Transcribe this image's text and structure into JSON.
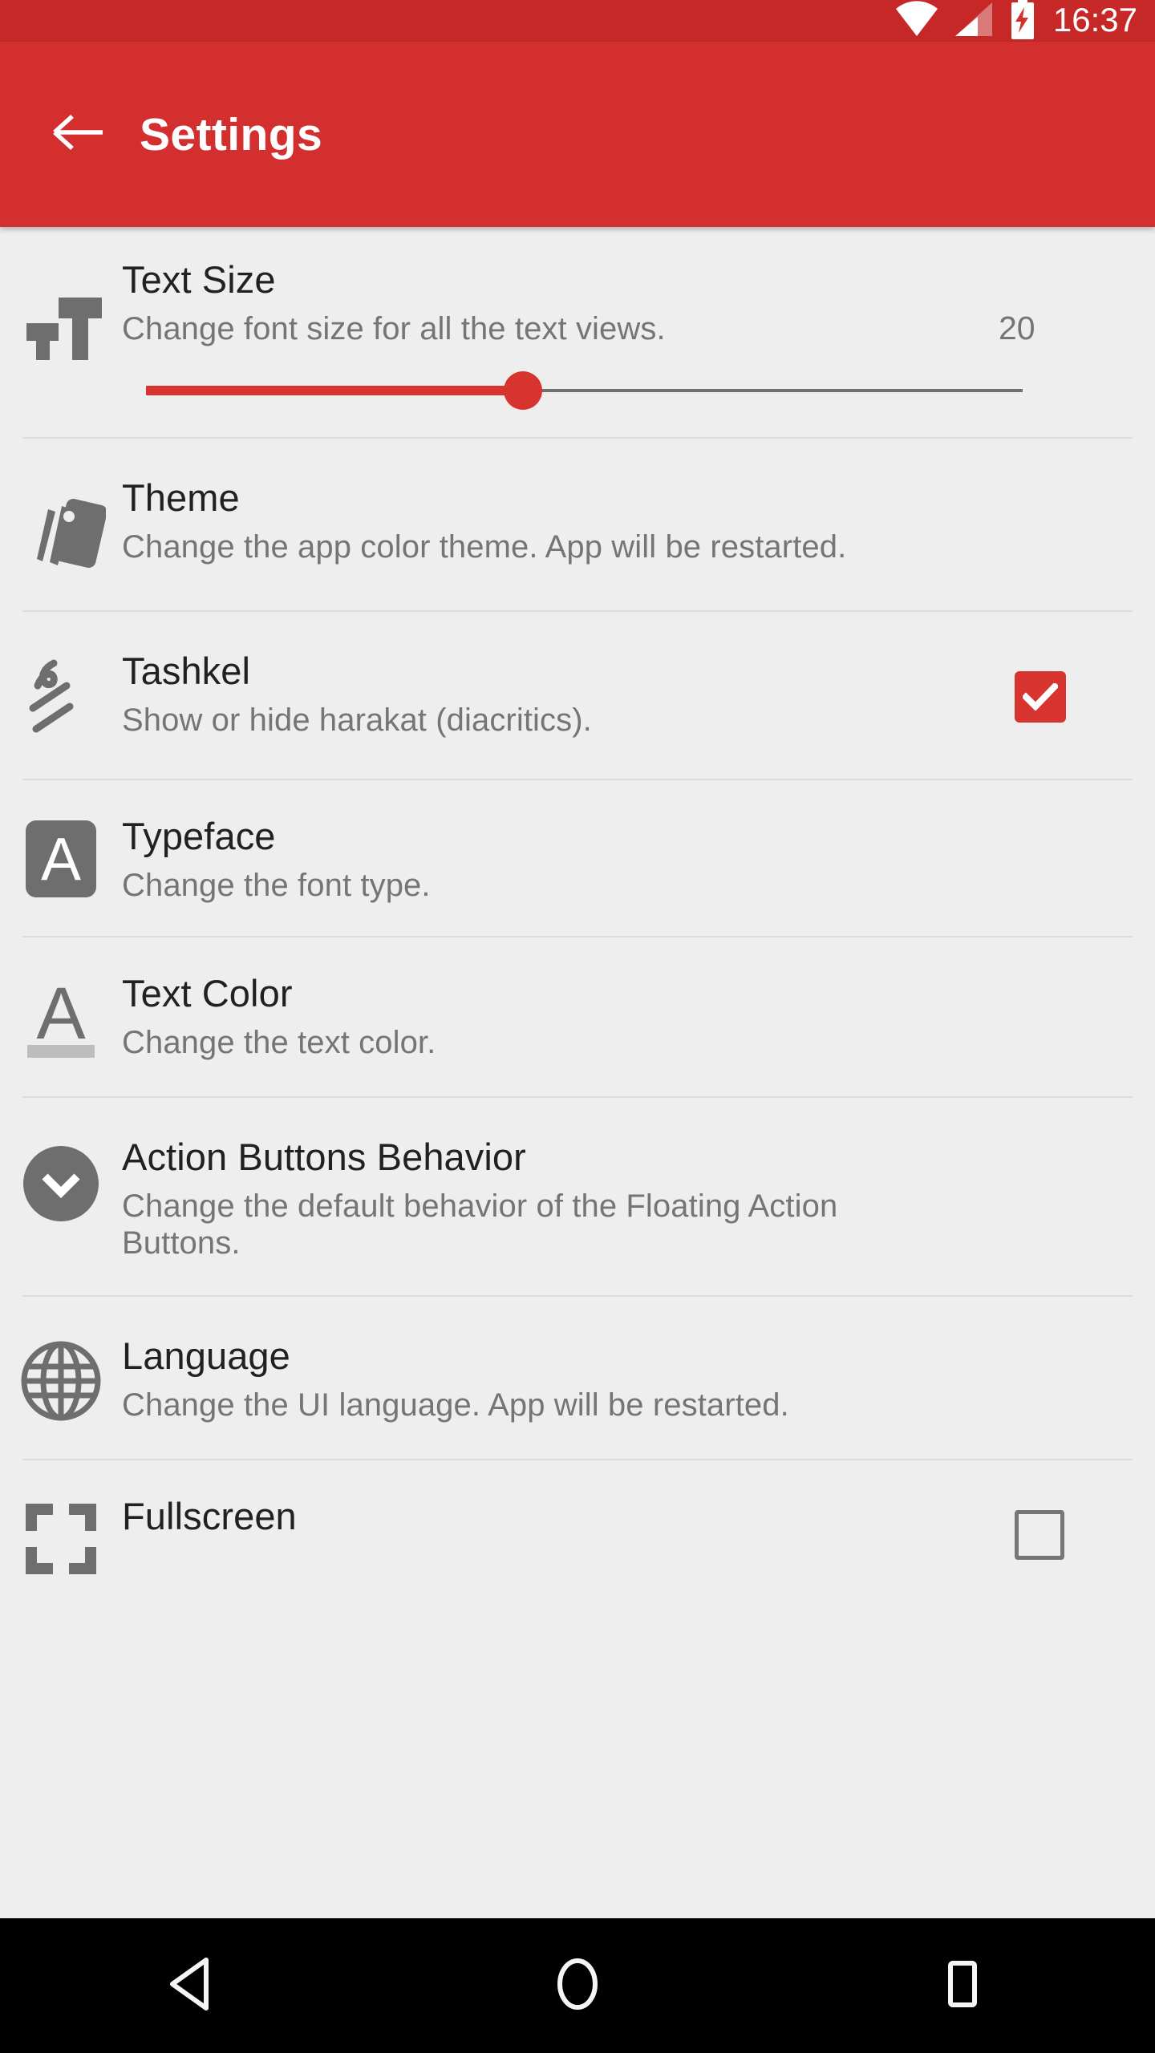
{
  "status_bar": {
    "time": "16:37",
    "icons": [
      "wifi-icon",
      "cellular-signal-icon",
      "battery-charging-icon"
    ],
    "background_color": "#c62828"
  },
  "app_bar": {
    "title": "Settings",
    "back_icon": "arrow-left-icon",
    "background_color": "#d32f2f",
    "text_color": "#ffffff"
  },
  "theme_colors": {
    "accent": "#d8342f",
    "primary": "#d32f2f",
    "primary_dark": "#c62828",
    "list_background": "#eeeeee",
    "title_text": "#212121",
    "subtitle_text": "#757575",
    "icon_gray": "#6e6e6e",
    "divider": "#dcdcdc"
  },
  "settings": [
    {
      "id": "text-size",
      "icon": "text-size-icon",
      "title": "Text Size",
      "subtitle": "Change font size for all the text views.",
      "value": "20",
      "control": "slider",
      "slider": {
        "percent": 43,
        "min": 0,
        "max": 100
      }
    },
    {
      "id": "theme",
      "icon": "color-palette-icon",
      "title": "Theme",
      "subtitle": "Change the app color theme. App will be restarted.",
      "control": "none"
    },
    {
      "id": "tashkel",
      "icon": "tashkel-diacritics-icon",
      "title": "Tashkel",
      "subtitle": "Show or hide harakat (diacritics).",
      "control": "checkbox",
      "checked": true
    },
    {
      "id": "typeface",
      "icon": "typeface-a-square-icon",
      "title": "Typeface",
      "subtitle": "Change the font type.",
      "control": "none"
    },
    {
      "id": "text-color",
      "icon": "text-color-a-icon",
      "title": "Text Color",
      "subtitle": "Change the text color.",
      "control": "none"
    },
    {
      "id": "action-buttons-behavior",
      "icon": "chevron-down-circle-icon",
      "title": "Action Buttons Behavior",
      "subtitle": "Change the default behavior of the Floating Action Buttons.",
      "control": "none"
    },
    {
      "id": "language",
      "icon": "globe-icon",
      "title": "Language",
      "subtitle": "Change the UI language. App will be restarted.",
      "control": "none"
    },
    {
      "id": "fullscreen",
      "icon": "fullscreen-corners-icon",
      "title": "Fullscreen",
      "subtitle": "",
      "control": "checkbox",
      "checked": false
    }
  ],
  "nav_bar": {
    "background_color": "#000000",
    "buttons": [
      {
        "id": "back",
        "icon": "nav-back-triangle-icon"
      },
      {
        "id": "home",
        "icon": "nav-home-circle-icon"
      },
      {
        "id": "recents",
        "icon": "nav-recents-square-icon"
      }
    ]
  }
}
